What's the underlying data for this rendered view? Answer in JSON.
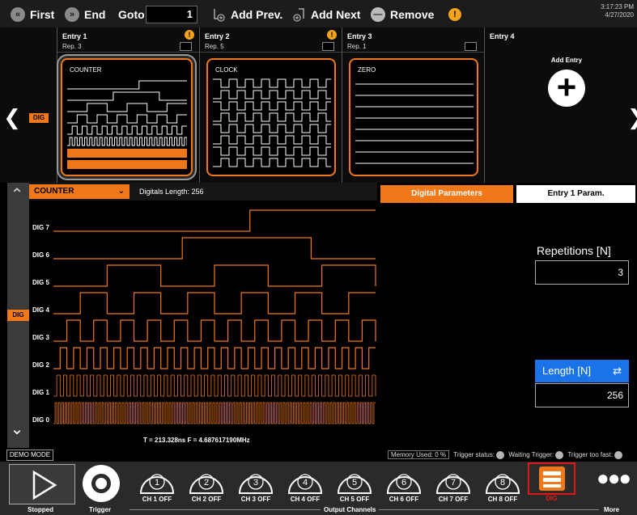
{
  "toolbar": {
    "first": "First",
    "end": "End",
    "goto": "Goto",
    "goto_value": "1",
    "add_prev": "Add Prev.",
    "add_next": "Add Next",
    "remove": "Remove",
    "warning": "!",
    "time": "3:17:23 PM",
    "date": "4/27/2020"
  },
  "entries": [
    {
      "title": "Entry 1",
      "rep": "Rep. 3",
      "waveform": "COUNTER",
      "warning": "!"
    },
    {
      "title": "Entry 2",
      "rep": "Rep. 5",
      "waveform": "CLOCK",
      "warning": "!"
    },
    {
      "title": "Entry 3",
      "rep": "Rep. 1",
      "waveform": "ZERO"
    },
    {
      "title": "Entry 4"
    }
  ],
  "add_entry": "Add Entry",
  "side_tag": "DIG",
  "selector": {
    "mode": "COUNTER",
    "digitals_length": "Digitals Length: 256"
  },
  "plot": {
    "channels": [
      "DIG 7",
      "DIG 6",
      "DIG 5",
      "DIG 4",
      "DIG 3",
      "DIG 2",
      "DIG 1",
      "DIG 0"
    ],
    "footer": "T = 213.328ns  F = 4.687617190MHz"
  },
  "params": {
    "tab_digital": "Digital Parameters",
    "tab_entry": "Entry 1 Param.",
    "repetitions_label": "Repetitions [N]",
    "repetitions_value": "3",
    "length_label": "Length [N]",
    "length_value": "256"
  },
  "status": {
    "demo_mode": "DEMO MODE",
    "memory_used": "Memory Used:  0 %",
    "trigger_status": "Trigger status:",
    "waiting_trigger": "Waiting Trigger:",
    "trigger_too_fast": "Trigger too fast:"
  },
  "bottom": {
    "stopped": "Stopped",
    "trigger": "Trigger",
    "output_channels": "Output Channels",
    "more": "More",
    "dig": "DIG",
    "channels": [
      {
        "num": "1",
        "label": "CH 1 OFF"
      },
      {
        "num": "2",
        "label": "CH 2 OFF"
      },
      {
        "num": "3",
        "label": "CH 3 OFF"
      },
      {
        "num": "4",
        "label": "CH 4 OFF"
      },
      {
        "num": "5",
        "label": "CH 5 OFF"
      },
      {
        "num": "6",
        "label": "CH 6 OFF"
      },
      {
        "num": "7",
        "label": "CH 7 OFF"
      },
      {
        "num": "8",
        "label": "CH 8 OFF"
      }
    ]
  },
  "colors": {
    "accent": "#f07818",
    "length_header": "#1a73e8"
  }
}
